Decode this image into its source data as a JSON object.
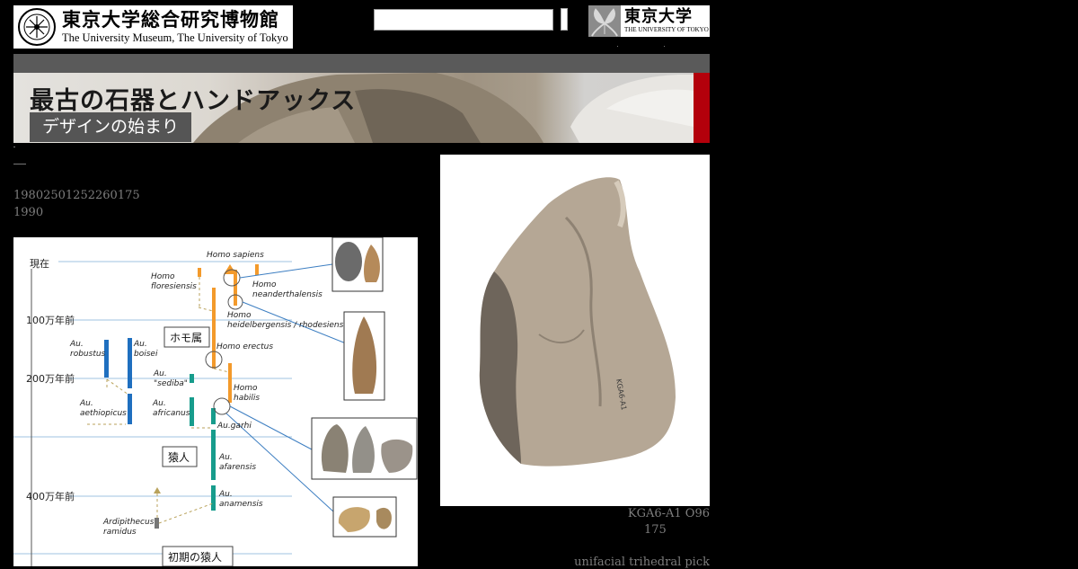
{
  "header": {
    "museum_name_jp": "東京大学総合研究博物館",
    "museum_name_en": "The University Museum, The University of Tokyo",
    "utokyo_jp": "東京大学",
    "utokyo_en": "THE UNIVERSITY OF TOKYO"
  },
  "search": {
    "value": "",
    "placeholder": ""
  },
  "banner": {
    "title": "最古の石器とハンドアックス",
    "subtitle": "デザインの始まり"
  },
  "content": {
    "line1": "19802501252260175",
    "line2": "1990"
  },
  "diagram": {
    "time_labels": [
      "現在",
      "100万年前",
      "200万年前",
      "400万年前"
    ],
    "group_labels": [
      "ホモ属",
      "猿人",
      "初期の猿人"
    ],
    "species": {
      "homo_sapiens": "Homo sapiens",
      "homo_floresiensis": [
        "Homo",
        "floresiensis"
      ],
      "homo_neanderthalensis": [
        "Homo",
        "neanderthalensis"
      ],
      "homo_heidelbergensis": [
        "Homo",
        "heidelbergensis / rhodesiensis"
      ],
      "homo_erectus": "Homo erectus",
      "homo_habilis": [
        "Homo",
        "habilis"
      ],
      "au_robustus": [
        "Au.",
        "robustus"
      ],
      "au_boisei": [
        "Au.",
        "boisei"
      ],
      "au_sediba": [
        "Au.",
        "\"sediba\""
      ],
      "au_aethiopicus": [
        "Au.",
        "aethiopicus"
      ],
      "au_africanus": [
        "Au.",
        "africanus"
      ],
      "au_garhi": "Au.garhi",
      "au_afarensis": [
        "Au.",
        "afarensis"
      ],
      "au_anamensis": [
        "Au.",
        "anamensis"
      ],
      "ardipithecus": [
        "Ardipithecus",
        "ramidus"
      ]
    },
    "colors": {
      "homo": "#f39a2b",
      "robust": "#1f6fbf",
      "au": "#179c8c",
      "ardi": "#777777",
      "guide": "#9fc3e0"
    }
  },
  "artifact": {
    "caption_id": "KGA6-A1 O96",
    "caption_num": "175",
    "caption_type": "unifacial trihedral pick"
  }
}
